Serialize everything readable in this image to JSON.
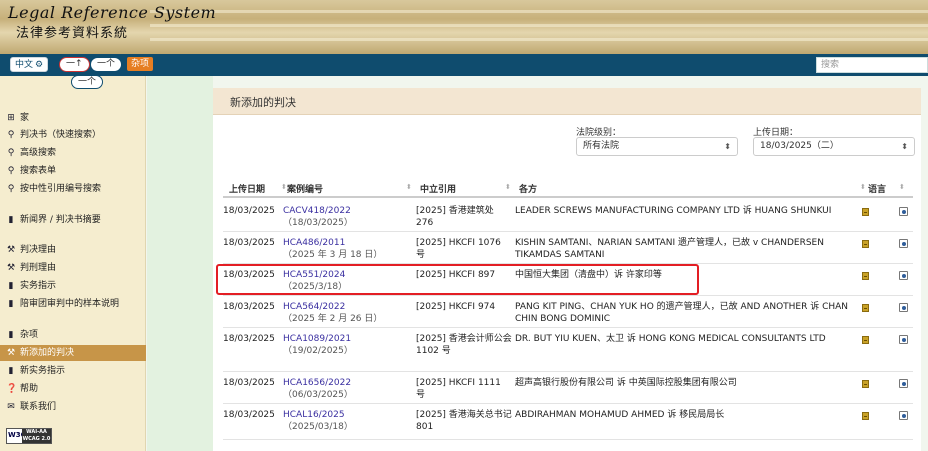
{
  "banner": {
    "title_en": "Legal Reference System",
    "title_zh": "法律参考資料系統"
  },
  "topbar": {
    "lang_label": "中文",
    "lang_icon": "gear-icon",
    "pill_1": "一↑",
    "pill_2": "一个",
    "pill_3": "一个",
    "orange_label": "杂项",
    "search_placeholder": "搜索"
  },
  "sidebar": {
    "items": [
      {
        "icon": "grid-icon",
        "label": "家"
      },
      {
        "icon": "search-icon",
        "label": "判决书（快速搜索）"
      },
      {
        "icon": "search-icon",
        "label": "高级搜索"
      },
      {
        "icon": "search-icon",
        "label": "搜索表单"
      },
      {
        "icon": "search-icon",
        "label": "按中性引用编号搜索"
      },
      {
        "icon": "file-icon",
        "label": "新闻界 / 判决书摘要"
      },
      {
        "icon": "hammer-icon",
        "label": "判决理由"
      },
      {
        "icon": "hammer-icon",
        "label": "判刑理由"
      },
      {
        "icon": "file-icon",
        "label": "实务指示"
      },
      {
        "icon": "file-icon",
        "label": "陪审团审判中的样本说明"
      },
      {
        "icon": "file-icon",
        "label": "杂项"
      },
      {
        "icon": "hammer-icon",
        "label": "新添加的判决"
      },
      {
        "icon": "file-icon",
        "label": "新实务指示"
      },
      {
        "icon": "help-icon",
        "label": "帮助"
      },
      {
        "icon": "mail-icon",
        "label": "联系我们"
      }
    ],
    "active_index": 11,
    "w3c_badge": {
      "w": "W3C",
      "line1": "WAI-AA",
      "line2": "WCAG 2.0"
    }
  },
  "main": {
    "title": "新添加的判决",
    "filter_court_label": "法院级别：",
    "filter_court_value": "所有法院",
    "filter_date_label": "上传日期：",
    "filter_date_value": "18/03/2025（二）",
    "columns": [
      "上传日期",
      "案例编号",
      "中立引用",
      "各方",
      "语言"
    ],
    "rows": [
      {
        "date": "18/03/2025",
        "case_no": "CACV418/2022",
        "case_date": "（18/03/2025）",
        "citation": "[2025] 香港建筑处 276",
        "parties": "LEADER SCREWS MANUFACTURING COMPANY LTD 诉 HUANG SHUNKUI"
      },
      {
        "date": "18/03/2025",
        "case_no": "HCA486/2011",
        "case_date": "（2025 年 3 月 18 日）",
        "citation": "[2025] HKCFI 1076 号",
        "parties": "KISHIN SAMTANI、NARIAN SAMTANI 遗产管理人，已故 v CHANDERSEN TIKAMDAS SAMTANI"
      },
      {
        "date": "18/03/2025",
        "case_no": "HCA551/2024",
        "case_date": "（2025/3/18）",
        "citation": "[2025] HKCFI 897",
        "parties": "中国恒大集团（清盘中）诉 许家印等"
      },
      {
        "date": "18/03/2025",
        "case_no": "HCA564/2022",
        "case_date": "（2025 年 2 月 26 日）",
        "citation": "[2025] HKCFI 974",
        "parties": "PANG KIT PING、CHAN YUK HO 的遗产管理人，已故 AND ANOTHER 诉 CHAN CHIN BONG DOMINIC"
      },
      {
        "date": "18/03/2025",
        "case_no": "HCA1089/2021",
        "case_date": "（19/02/2025）",
        "citation": "[2025] 香港会计师公会 1102 号",
        "parties": "DR. BUT YIU KUEN、太卫 诉 HONG KONG MEDICAL CONSULTANTS LTD"
      },
      {
        "date": "18/03/2025",
        "case_no": "HCA1656/2022",
        "case_date": "（06/03/2025）",
        "citation": "[2025] HKCFI 1111 号",
        "parties": "超声高银行股份有限公司 诉 中英国际控股集团有限公司"
      },
      {
        "date": "18/03/2025",
        "case_no": "HCAL16/2025",
        "case_date": "（2025/03/18）",
        "citation": "[2025] 香港海关总书记 801",
        "parties": "ABDIRAHMAN MOHAMUD AHMED 诉 移民局局长"
      }
    ],
    "highlighted_row": 2,
    "highlight_color": "#e31e24"
  }
}
